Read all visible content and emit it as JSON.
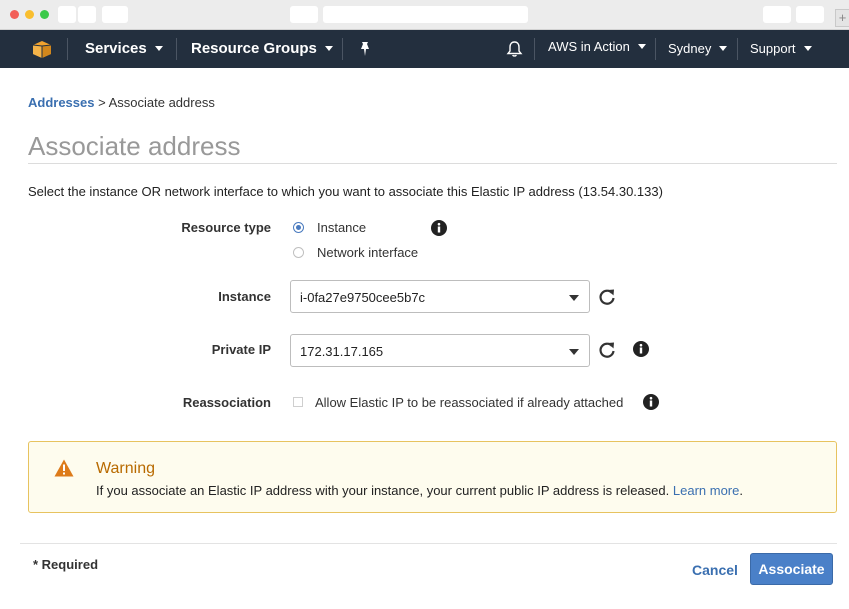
{
  "nav": {
    "services_label": "Services",
    "resource_groups_label": "Resource Groups",
    "account_label": "AWS in Action",
    "region_label": "Sydney",
    "support_label": "Support"
  },
  "breadcrumb": {
    "parent": "Addresses",
    "separator": ">",
    "current": "Associate address"
  },
  "page": {
    "title": "Associate address",
    "intro": "Select the instance OR network interface to which you want to associate this Elastic IP address (13.54.30.133)"
  },
  "form": {
    "resource_type_label": "Resource type",
    "option_instance": "Instance",
    "option_network_interface": "Network interface",
    "selected_resource_type": "Instance",
    "instance_label": "Instance",
    "instance_value": "i-0fa27e9750cee5b7c",
    "private_ip_label": "Private IP",
    "private_ip_value": "172.31.17.165",
    "reassociation_label": "Reassociation",
    "reassociation_text": "Allow Elastic IP to be reassociated if already attached"
  },
  "warning": {
    "title": "Warning",
    "text": "If you associate an Elastic IP address with your instance, your current public IP address is released.",
    "link": "Learn more",
    "trailing": "."
  },
  "footer": {
    "required_note": "* Required",
    "cancel_label": "Cancel",
    "associate_label": "Associate"
  },
  "colors": {
    "nav_bg": "#232f3e",
    "link": "#3a6fb0",
    "primary_button": "#4a80c8",
    "warning_border": "#e7c35f",
    "warning_title": "#b86a00"
  }
}
